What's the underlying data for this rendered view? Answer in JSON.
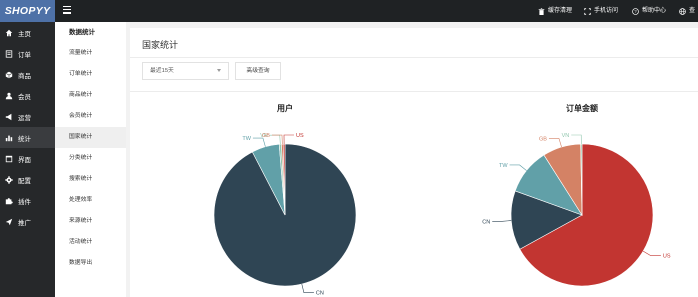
{
  "topbar": {
    "logo": "SHOPYY",
    "links": [
      {
        "label": "缓存清理",
        "icon": "trash-icon"
      },
      {
        "label": "手机访问",
        "icon": "expand-icon"
      },
      {
        "label": "帮助中心",
        "icon": "help-icon"
      },
      {
        "label": "查",
        "icon": "globe-icon"
      }
    ]
  },
  "sidebar": {
    "items": [
      {
        "label": "主页",
        "icon": "home-icon"
      },
      {
        "label": "订单",
        "icon": "order-icon"
      },
      {
        "label": "商品",
        "icon": "box-icon"
      },
      {
        "label": "会员",
        "icon": "user-icon"
      },
      {
        "label": "运营",
        "icon": "megaphone-icon"
      },
      {
        "label": "统计",
        "icon": "bar-chart-icon"
      },
      {
        "label": "界面",
        "icon": "layout-icon"
      },
      {
        "label": "配置",
        "icon": "gear-icon"
      },
      {
        "label": "插件",
        "icon": "puzzle-icon"
      },
      {
        "label": "推广",
        "icon": "send-icon"
      }
    ],
    "active_index": 5
  },
  "submenu": {
    "title": "数据统计",
    "items": [
      "流量统计",
      "订单统计",
      "商品统计",
      "会员统计",
      "国家统计",
      "分类统计",
      "搜索统计",
      "处理效率",
      "来源统计",
      "活动统计",
      "数据导出"
    ],
    "active_index": 4
  },
  "main": {
    "title": "国家统计",
    "range_select": "最近15天",
    "advanced_button": "高级查询"
  },
  "colors": {
    "dark_slate": "#2f4554",
    "teal": "#61a0a8",
    "red": "#c23531",
    "salmon": "#d48265",
    "mint": "#91c7ae"
  },
  "chart_data": [
    {
      "type": "pie",
      "title": "用户",
      "slices": [
        {
          "name": "CN",
          "value": 92.4,
          "color": "#2f4554"
        },
        {
          "name": "TW",
          "value": 6.3,
          "color": "#61a0a8"
        },
        {
          "name": "VN",
          "value": 0.5,
          "color": "#91c7ae"
        },
        {
          "name": "GB",
          "value": 0.4,
          "color": "#d48265"
        },
        {
          "name": "US",
          "value": 0.4,
          "color": "#c23531"
        }
      ]
    },
    {
      "type": "pie",
      "title": "订单金额",
      "slices": [
        {
          "name": "US",
          "value": 67.0,
          "color": "#c23531"
        },
        {
          "name": "CN",
          "value": 13.5,
          "color": "#2f4554"
        },
        {
          "name": "TW",
          "value": 10.5,
          "color": "#61a0a8"
        },
        {
          "name": "GB",
          "value": 8.7,
          "color": "#d48265"
        },
        {
          "name": "VN",
          "value": 0.3,
          "color": "#91c7ae"
        }
      ]
    }
  ]
}
